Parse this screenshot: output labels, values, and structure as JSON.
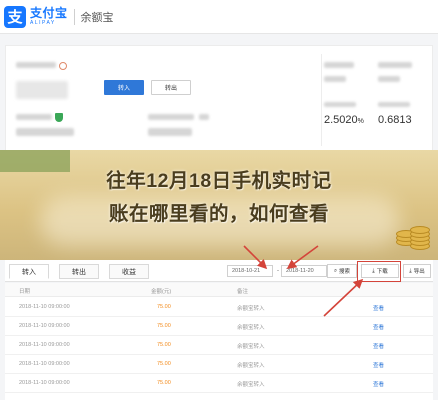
{
  "header": {
    "logo_glyph": "支",
    "logo_cn": "支付宝",
    "logo_en": "ALIPAY",
    "app_name": "余额宝"
  },
  "panel": {
    "transfer_in_label": "转入",
    "transfer_out_label": "转出",
    "rate_1": "2.5020",
    "rate_1_unit": "%",
    "rate_2": "0.6813"
  },
  "banner": {
    "line1": "往年12月18日手机实时记",
    "line2": "账在哪里看的，如何查看"
  },
  "tabs": [
    {
      "label": "转入"
    },
    {
      "label": "转出"
    },
    {
      "label": "收益"
    }
  ],
  "toolbar": {
    "date_from": "2018-10-21",
    "date_to": "2018-11-20",
    "date_sep": "-",
    "search_label": "搜索",
    "download_label": "下载",
    "extra_label": "导出"
  },
  "table": {
    "columns": [
      "日期",
      "金额(元)",
      "备注"
    ],
    "rows": [
      {
        "date": "2018-11-10 09:00:00",
        "amount": "75.00",
        "note": "余额宝转入",
        "action": "查看"
      },
      {
        "date": "2018-11-10 09:00:00",
        "amount": "75.00",
        "note": "余额宝转入",
        "action": "查看"
      },
      {
        "date": "2018-11-10 09:00:00",
        "amount": "75.00",
        "note": "余额宝转入",
        "action": "查看"
      },
      {
        "date": "2018-11-10 09:00:00",
        "amount": "75.00",
        "note": "余额宝转入",
        "action": "查看"
      },
      {
        "date": "2018-11-10 09:00:00",
        "amount": "75.00",
        "note": "余额宝转入",
        "action": "查看"
      }
    ]
  },
  "colors": {
    "brand_blue": "#1677ff",
    "button_blue": "#2f78d8",
    "amount_orange": "#f28b1d",
    "arrow_red": "#d4443a"
  }
}
